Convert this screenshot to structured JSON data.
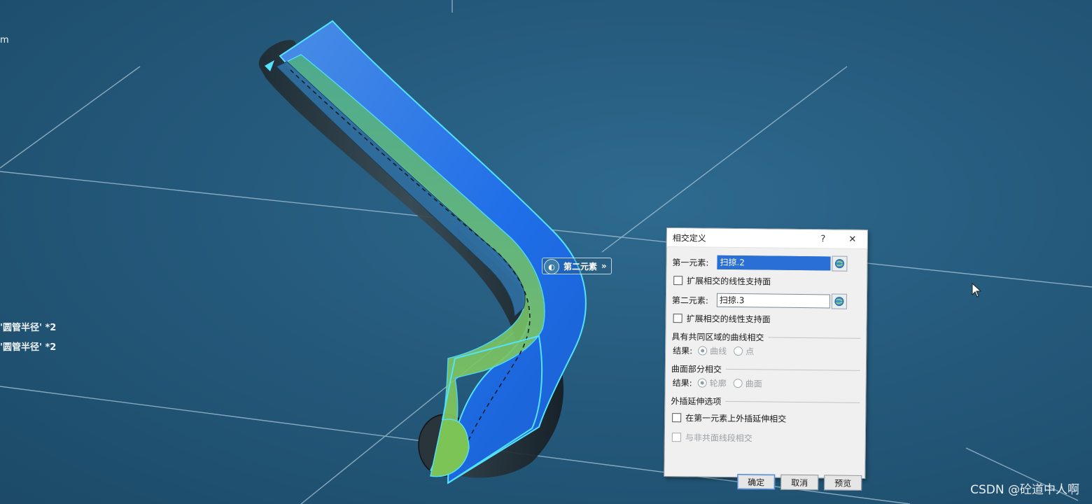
{
  "viewport": {
    "tree_fragment_top": "m",
    "tree_items": [
      "'圆管半径' *2",
      "'圆管半径' *2"
    ]
  },
  "float_tag": {
    "label": "第二元素",
    "chevron": "»"
  },
  "dialog": {
    "title": "相交定义",
    "help": "?",
    "close": "✕",
    "first_element_label": "第一元素:",
    "first_element_value": "扫掠.2",
    "extend_first_label": "扩展相交的线性支持面",
    "second_element_label": "第二元素:",
    "second_element_value": "扫掠.3",
    "extend_second_label": "扩展相交的线性支持面",
    "curve_section": "具有共同区域的曲线相交",
    "curve_result_label": "结果:",
    "curve_options": [
      "曲线",
      "点"
    ],
    "surface_section": "曲面部分相交",
    "surface_result_label": "结果:",
    "surface_options": [
      "轮廓",
      "曲面"
    ],
    "extrap_section": "外插延伸选项",
    "extrap_option": "在第一元素上外插延伸相交",
    "nonco_option": "与非共面线段相交",
    "ok": "确定",
    "cancel": "取消",
    "preview": "预览"
  },
  "watermark": "CSDN @砼道中人啊",
  "colors": {
    "background": "#255a7c",
    "surface_blue": "#2f7be8",
    "surface_green": "#6cc77a",
    "highlight": "#53e3ff",
    "selection": "#2a6fd6"
  }
}
